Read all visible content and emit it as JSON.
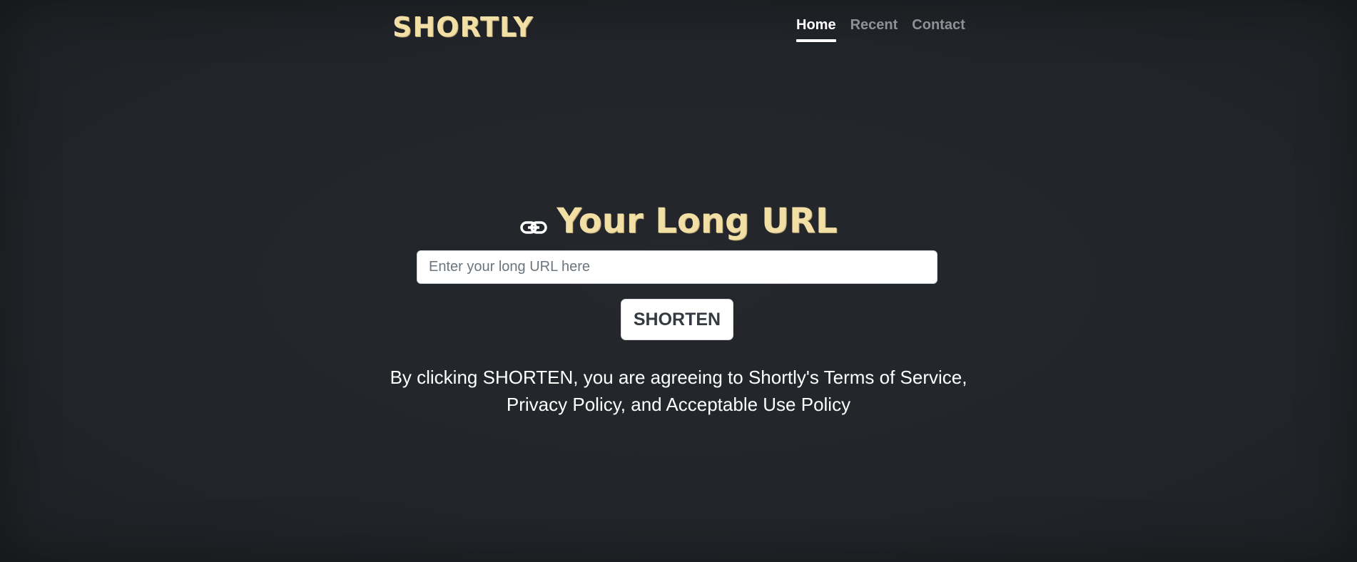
{
  "header": {
    "logo": "SHORTLY",
    "nav": [
      {
        "label": "Home",
        "active": true
      },
      {
        "label": "Recent",
        "active": false
      },
      {
        "label": "Contact",
        "active": false
      }
    ]
  },
  "main": {
    "icon": "link-icon",
    "title": "Your Long URL",
    "input": {
      "placeholder": "Enter your long URL here",
      "value": ""
    },
    "button_label": "SHORTEN",
    "terms_line1": "By clicking SHORTEN, you are agreeing to Shortly's Terms of Service,",
    "terms_line2": "Privacy Policy, and Acceptable Use Policy"
  },
  "colors": {
    "background": "#22252a",
    "accent": "#f2dfa6",
    "nav_inactive": "#8e9196",
    "text": "#ffffff"
  }
}
